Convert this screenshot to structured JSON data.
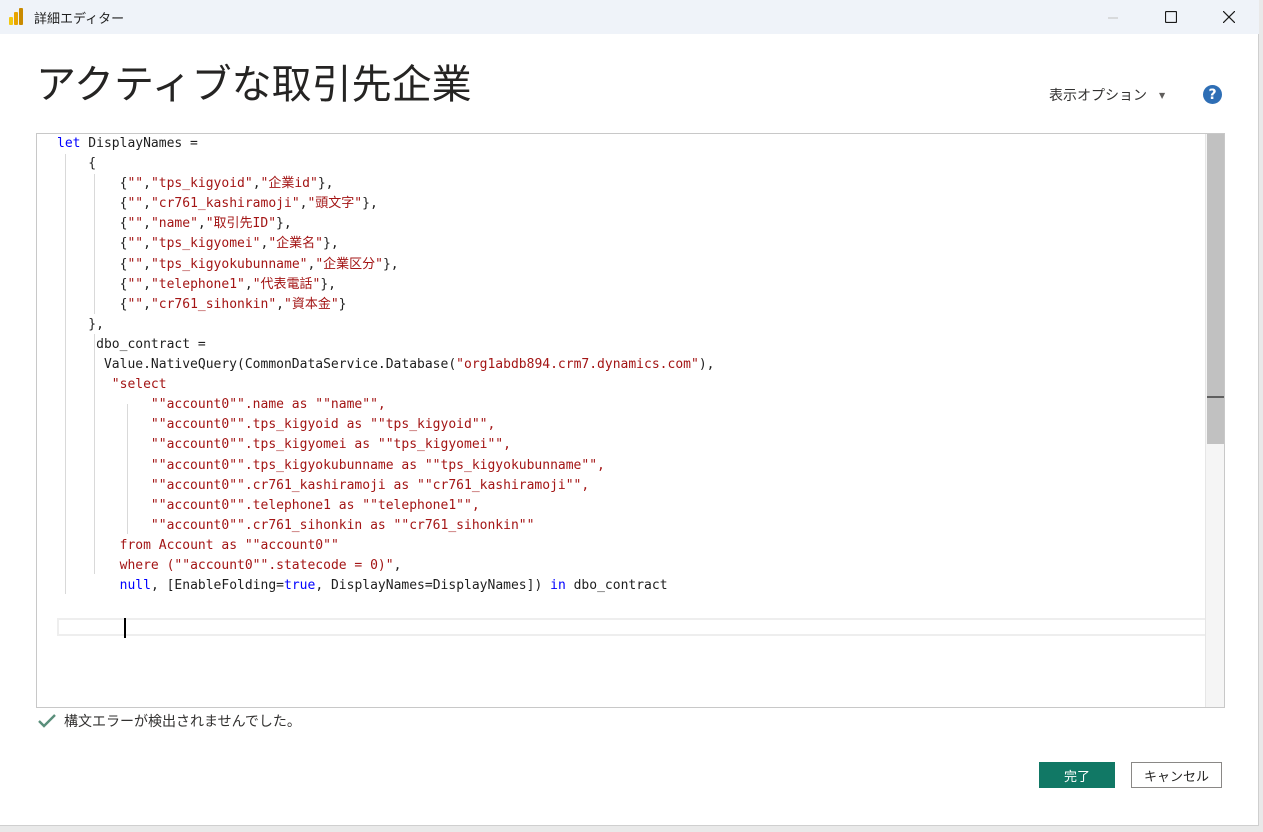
{
  "window": {
    "title": "詳細エディター",
    "minimize_icon": "minimize-icon",
    "maximize_icon": "maximize-icon",
    "close_icon": "close-icon"
  },
  "header": {
    "query_name": "アクティブな取引先企業",
    "view_options_label": "表示オプション",
    "help_icon": "help-icon"
  },
  "editor": {
    "lines": [
      [
        {
          "t": "let",
          "c": "kw"
        },
        {
          "t": " DisplayNames =",
          "c": ""
        }
      ],
      [
        {
          "t": "    {",
          "c": ""
        }
      ],
      [
        {
          "t": "        {",
          "c": ""
        },
        {
          "t": "\"\"",
          "c": "str"
        },
        {
          "t": ",",
          "c": ""
        },
        {
          "t": "\"tps_kigyoid\"",
          "c": "str"
        },
        {
          "t": ",",
          "c": ""
        },
        {
          "t": "\"企業id\"",
          "c": "str"
        },
        {
          "t": "},",
          "c": ""
        }
      ],
      [
        {
          "t": "        {",
          "c": ""
        },
        {
          "t": "\"\"",
          "c": "str"
        },
        {
          "t": ",",
          "c": ""
        },
        {
          "t": "\"cr761_kashiramoji\"",
          "c": "str"
        },
        {
          "t": ",",
          "c": ""
        },
        {
          "t": "\"頭文字\"",
          "c": "str"
        },
        {
          "t": "},",
          "c": ""
        }
      ],
      [
        {
          "t": "        {",
          "c": ""
        },
        {
          "t": "\"\"",
          "c": "str"
        },
        {
          "t": ",",
          "c": ""
        },
        {
          "t": "\"name\"",
          "c": "str"
        },
        {
          "t": ",",
          "c": ""
        },
        {
          "t": "\"取引先ID\"",
          "c": "str"
        },
        {
          "t": "},",
          "c": ""
        }
      ],
      [
        {
          "t": "        {",
          "c": ""
        },
        {
          "t": "\"\"",
          "c": "str"
        },
        {
          "t": ",",
          "c": ""
        },
        {
          "t": "\"tps_kigyomei\"",
          "c": "str"
        },
        {
          "t": ",",
          "c": ""
        },
        {
          "t": "\"企業名\"",
          "c": "str"
        },
        {
          "t": "},",
          "c": ""
        }
      ],
      [
        {
          "t": "        {",
          "c": ""
        },
        {
          "t": "\"\"",
          "c": "str"
        },
        {
          "t": ",",
          "c": ""
        },
        {
          "t": "\"tps_kigyokubunname\"",
          "c": "str"
        },
        {
          "t": ",",
          "c": ""
        },
        {
          "t": "\"企業区分\"",
          "c": "str"
        },
        {
          "t": "},",
          "c": ""
        }
      ],
      [
        {
          "t": "        {",
          "c": ""
        },
        {
          "t": "\"\"",
          "c": "str"
        },
        {
          "t": ",",
          "c": ""
        },
        {
          "t": "\"telephone1\"",
          "c": "str"
        },
        {
          "t": ",",
          "c": ""
        },
        {
          "t": "\"代表電話\"",
          "c": "str"
        },
        {
          "t": "},",
          "c": ""
        }
      ],
      [
        {
          "t": "        {",
          "c": ""
        },
        {
          "t": "\"\"",
          "c": "str"
        },
        {
          "t": ",",
          "c": ""
        },
        {
          "t": "\"cr761_sihonkin\"",
          "c": "str"
        },
        {
          "t": ",",
          "c": ""
        },
        {
          "t": "\"資本金\"",
          "c": "str"
        },
        {
          "t": "}",
          "c": ""
        }
      ],
      [
        {
          "t": "    },",
          "c": ""
        }
      ],
      [
        {
          "t": "     dbo_contract =",
          "c": ""
        }
      ],
      [
        {
          "t": "      Value.NativeQuery(CommonDataService.Database(",
          "c": ""
        },
        {
          "t": "\"org1abdb894.crm7.dynamics.com\"",
          "c": "str"
        },
        {
          "t": "),",
          "c": ""
        }
      ],
      [
        {
          "t": "       ",
          "c": ""
        },
        {
          "t": "\"select",
          "c": "str"
        }
      ],
      [
        {
          "t": "            ",
          "c": ""
        },
        {
          "t": "\"\"account0\"\".name as \"\"name\"\",",
          "c": "str"
        }
      ],
      [
        {
          "t": "            ",
          "c": ""
        },
        {
          "t": "\"\"account0\"\".tps_kigyoid as \"\"tps_kigyoid\"\",",
          "c": "str"
        }
      ],
      [
        {
          "t": "            ",
          "c": ""
        },
        {
          "t": "\"\"account0\"\".tps_kigyomei as \"\"tps_kigyomei\"\",",
          "c": "str"
        }
      ],
      [
        {
          "t": "            ",
          "c": ""
        },
        {
          "t": "\"\"account0\"\".tps_kigyokubunname as \"\"tps_kigyokubunname\"\",",
          "c": "str"
        }
      ],
      [
        {
          "t": "            ",
          "c": ""
        },
        {
          "t": "\"\"account0\"\".cr761_kashiramoji as \"\"cr761_kashiramoji\"\",",
          "c": "str"
        }
      ],
      [
        {
          "t": "            ",
          "c": ""
        },
        {
          "t": "\"\"account0\"\".telephone1 as \"\"telephone1\"\",",
          "c": "str"
        }
      ],
      [
        {
          "t": "            ",
          "c": ""
        },
        {
          "t": "\"\"account0\"\".cr761_sihonkin as \"\"cr761_sihonkin\"\"",
          "c": "str"
        }
      ],
      [
        {
          "t": "        ",
          "c": ""
        },
        {
          "t": "from Account as \"\"account0\"\"",
          "c": "str"
        }
      ],
      [
        {
          "t": "        ",
          "c": ""
        },
        {
          "t": "where (\"\"account0\"\".statecode = 0)\"",
          "c": "str"
        },
        {
          "t": ",",
          "c": ""
        }
      ],
      [
        {
          "t": "        ",
          "c": ""
        },
        {
          "t": "null",
          "c": "kw"
        },
        {
          "t": ", [EnableFolding=",
          "c": ""
        },
        {
          "t": "true",
          "c": "kw"
        },
        {
          "t": ", DisplayNames=DisplayNames]) ",
          "c": ""
        },
        {
          "t": "in",
          "c": "kw"
        },
        {
          "t": " dbo_contract",
          "c": ""
        }
      ],
      [
        {
          "t": "",
          "c": ""
        }
      ],
      [
        {
          "t": "",
          "c": ""
        }
      ]
    ]
  },
  "status": {
    "check_icon": "checkmark-icon",
    "message": "構文エラーが検出されませんでした。"
  },
  "footer": {
    "done_label": "完了",
    "cancel_label": "キャンセル"
  },
  "colors": {
    "keyword": "#0000ff",
    "string": "#a31515",
    "primary_button": "#117865",
    "help": "#2e6eb5",
    "check": "#5a8f7b"
  }
}
